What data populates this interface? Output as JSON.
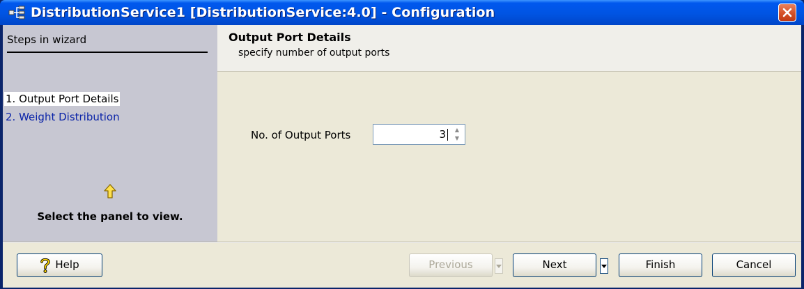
{
  "window": {
    "title": "DistributionService1 [DistributionService:4.0] - Configuration",
    "title_icon": "distribution-network-icon",
    "close_icon": "close-icon"
  },
  "steps": {
    "heading": "Steps in wizard",
    "items": [
      {
        "label": "1. Output Port Details",
        "state": "active"
      },
      {
        "label": "2. Weight Distribution",
        "state": "link"
      }
    ],
    "hint_icon": "arrow-up-icon",
    "hint": "Select the panel to view."
  },
  "panel": {
    "title": "Output Port Details",
    "subtitle": "specify number of output ports",
    "field": {
      "label": "No. of Output Ports",
      "value": "3"
    }
  },
  "footer": {
    "help": {
      "label": "Help",
      "icon": "help-question-icon"
    },
    "previous": {
      "label": "Previous",
      "enabled": false
    },
    "next": {
      "label": "Next",
      "enabled": true
    },
    "finish": {
      "label": "Finish",
      "enabled": true
    },
    "cancel": {
      "label": "Cancel",
      "enabled": true
    }
  },
  "colors": {
    "titlebar": "#0054E3",
    "steps_panel": "#C7C7D2",
    "step_link": "#0B24A8",
    "dialog_face": "#ECE9D8"
  }
}
